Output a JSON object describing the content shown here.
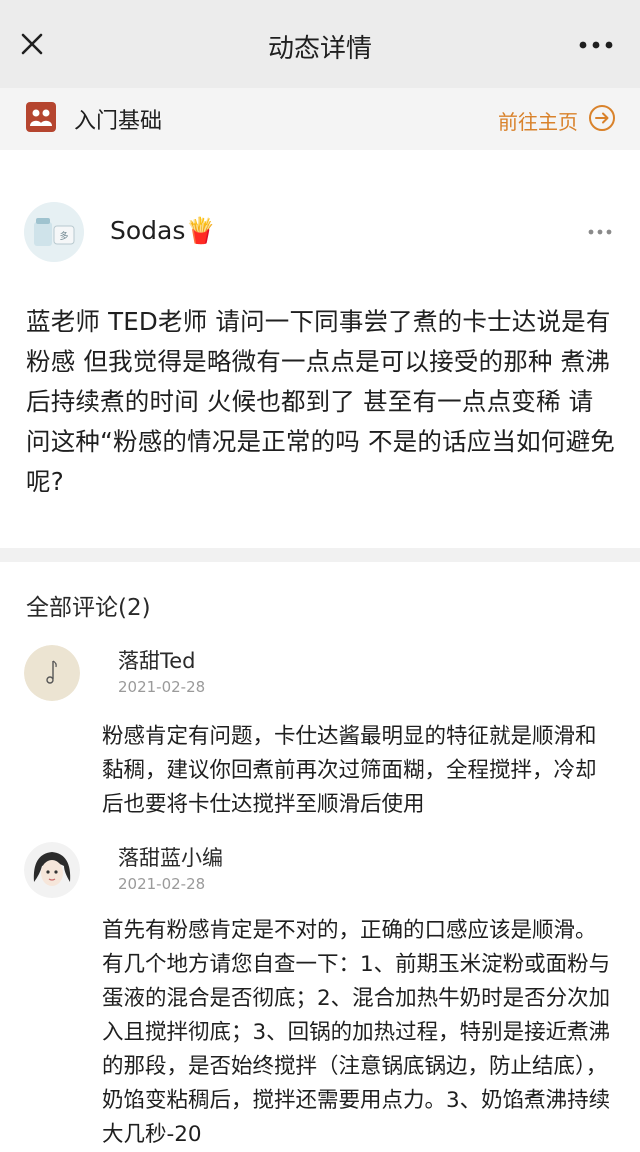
{
  "topbar": {
    "title": "动态详情",
    "close_icon": "close-icon",
    "more_icon": "more-dots-icon"
  },
  "circle": {
    "name": "入门基础",
    "icon": "group-icon",
    "goto_label": "前往主页",
    "goto_icon": "arrow-right-circle-icon",
    "accent_color": "#d9822b"
  },
  "post": {
    "author": "Sodas🍟",
    "content": "蓝老师 TED老师 请问一下同事尝了煮的卡士达说是有粉感 但我觉得是略微有一点点是可以接受的那种 煮沸后持续煮的时间 火候也都到了 甚至有一点点变稀 请问这种“粉感的情况是正常的吗 不是的话应当如何避免呢?"
  },
  "comments_section": {
    "header": "全部评论(2)",
    "comments": [
      {
        "author": "落甜Ted",
        "date": "2021-02-28",
        "content": "粉感肯定有问题，卡仕达酱最明显的特征就是顺滑和黏稠，建议你回煮前再次过筛面糊，全程搅拌，冷却后也要将卡仕达搅拌至顺滑后使用"
      },
      {
        "author": "落甜蓝小编",
        "date": "2021-02-28",
        "content": "首先有粉感肯定是不对的，正确的口感应该是顺滑。有几个地方请您自查一下：1、前期玉米淀粉或面粉与蛋液的混合是否彻底；2、混合加热牛奶时是否分次加入且搅拌彻底；3、回锅的加热过程，特别是接近煮沸的那段，是否始终搅拌（注意锅底锅边，防止结底），奶馅变粘稠后，搅拌还需要用点力。3、奶馅煮沸持续大几秒-20"
      }
    ]
  }
}
